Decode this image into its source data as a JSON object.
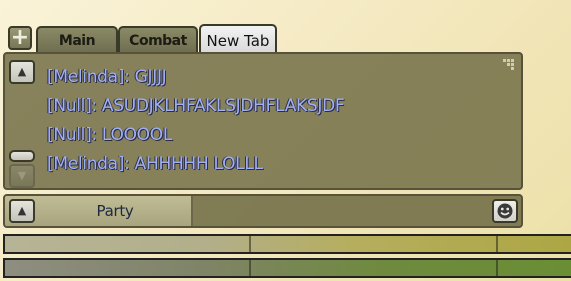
{
  "tabs": [
    {
      "label": "Main",
      "active": false
    },
    {
      "label": "Combat",
      "active": false
    },
    {
      "label": "New Tab",
      "active": true
    }
  ],
  "chat": {
    "lines": [
      "[Melinda]: GJJJJ",
      "[Null]: ASUDJKLHFAKLSJDHFLAKSJDF",
      "[Null]: LOOOOL",
      "[Melinda]: AHHHHH LOLLL"
    ],
    "text_color": "#9fb0f7"
  },
  "input": {
    "channel": "Party",
    "value": "",
    "placeholder": ""
  },
  "icons": {
    "add_tab": "plus-icon",
    "scroll_up": "chevron-up-icon",
    "scroll_down": "chevron-down-icon",
    "channel": "chevron-up-icon",
    "emote": "smiley-icon",
    "resize": "resize-grip-icon"
  },
  "bars": [
    {
      "fill_fraction": 1.0,
      "color": "#b2af8a"
    },
    {
      "fill_fraction": 1.0,
      "color": "#6f8a3f"
    }
  ]
}
